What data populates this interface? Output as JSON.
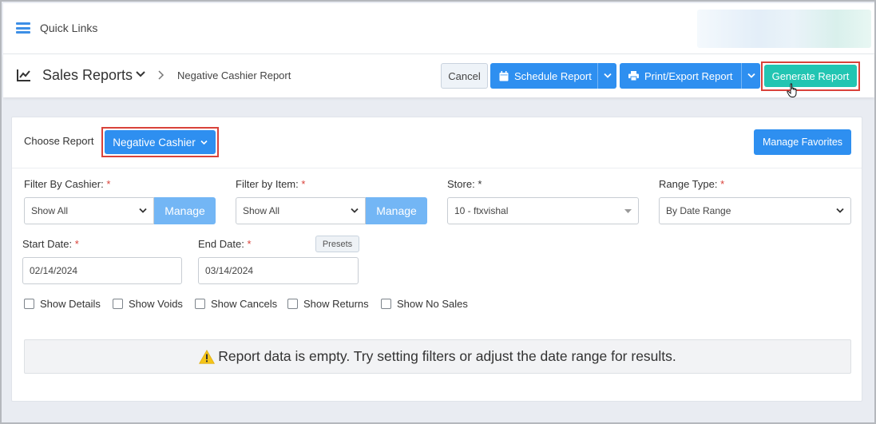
{
  "quick_links": {
    "label": "Quick Links",
    "icon": "hamburger-menu-icon"
  },
  "header": {
    "title": "Sales Reports",
    "breadcrumb_current": "Negative Cashier Report",
    "cancel_label": "Cancel",
    "schedule_label": "Schedule Report",
    "print_label": "Print/Export Report",
    "generate_label": "Generate Report"
  },
  "panel": {
    "choose_label": "Choose Report",
    "selected_report": "Negative Cashier",
    "manage_favorites_label": "Manage Favorites",
    "filters": {
      "cashier": {
        "label": "Filter By Cashier:",
        "value": "Show All",
        "manage_label": "Manage"
      },
      "item": {
        "label": "Filter by Item:",
        "value": "Show All",
        "manage_label": "Manage"
      },
      "store": {
        "label": "Store:",
        "value": "10 - ftxvishal"
      },
      "range_type": {
        "label": "Range Type:",
        "value": "By Date Range"
      }
    },
    "required_mark": "*",
    "start_date": {
      "label": "Start Date:",
      "value": "02/14/2024"
    },
    "end_date": {
      "label": "End Date:",
      "value": "03/14/2024"
    },
    "presets_label": "Presets",
    "checkboxes": [
      {
        "label": "Show Details",
        "checked": false
      },
      {
        "label": "Show Voids",
        "checked": false
      },
      {
        "label": "Show Cancels",
        "checked": false
      },
      {
        "label": "Show Returns",
        "checked": false
      },
      {
        "label": "Show No Sales",
        "checked": false
      }
    ],
    "empty_message": "Report data is empty. Try setting filters or adjust the date range for results."
  },
  "colors": {
    "primary_blue": "#2e8ff0",
    "manage_blue": "#73b6f5",
    "generate_teal": "#22c5b2",
    "highlight_red": "#d9423a",
    "warning_yellow": "#f5c518"
  }
}
